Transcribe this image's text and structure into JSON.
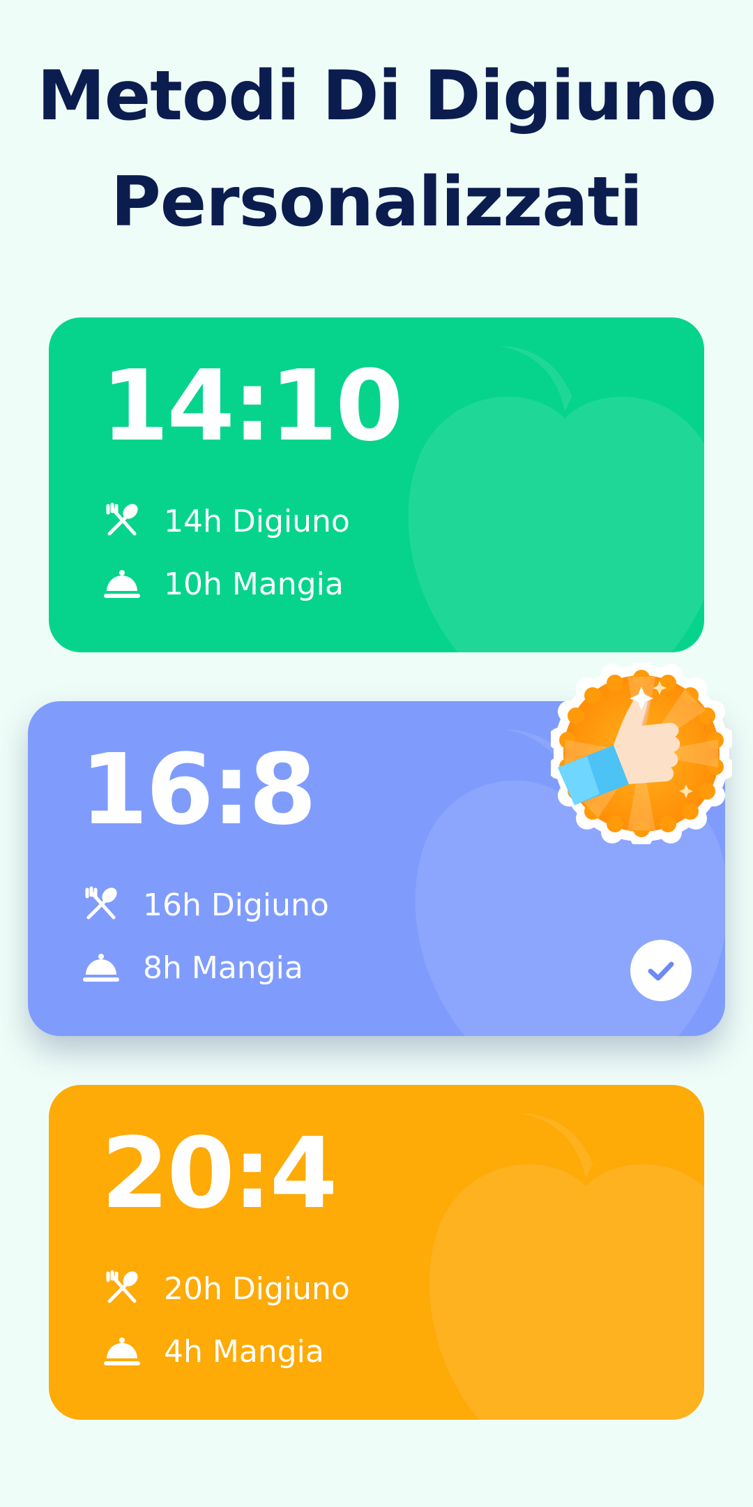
{
  "title": {
    "line1": "Metodi Di Digiuno",
    "line2": "Personalizzati"
  },
  "plans": [
    {
      "ratio": "14:10",
      "fast_label": "14h Digiuno",
      "eat_label": "10h Mangia",
      "color": "#06d48c",
      "selected": false
    },
    {
      "ratio": "16:8",
      "fast_label": "16h Digiuno",
      "eat_label": "8h Mangia",
      "color": "#7f9cfd",
      "selected": true
    },
    {
      "ratio": "20:4",
      "fast_label": "20h Digiuno",
      "eat_label": "4h Mangia",
      "color": "#feaa07",
      "selected": false
    }
  ],
  "icons": {
    "fast": "fork-spoon-crossed-icon",
    "eat": "cloche-icon",
    "selected": "check-icon",
    "recommended": "thumbs-up-badge-icon",
    "background": "apple-icon"
  },
  "colors": {
    "title": "#0b1d4f",
    "background": "#effdf8",
    "check": "#6b8af5",
    "badge": "#ff9a0a"
  }
}
